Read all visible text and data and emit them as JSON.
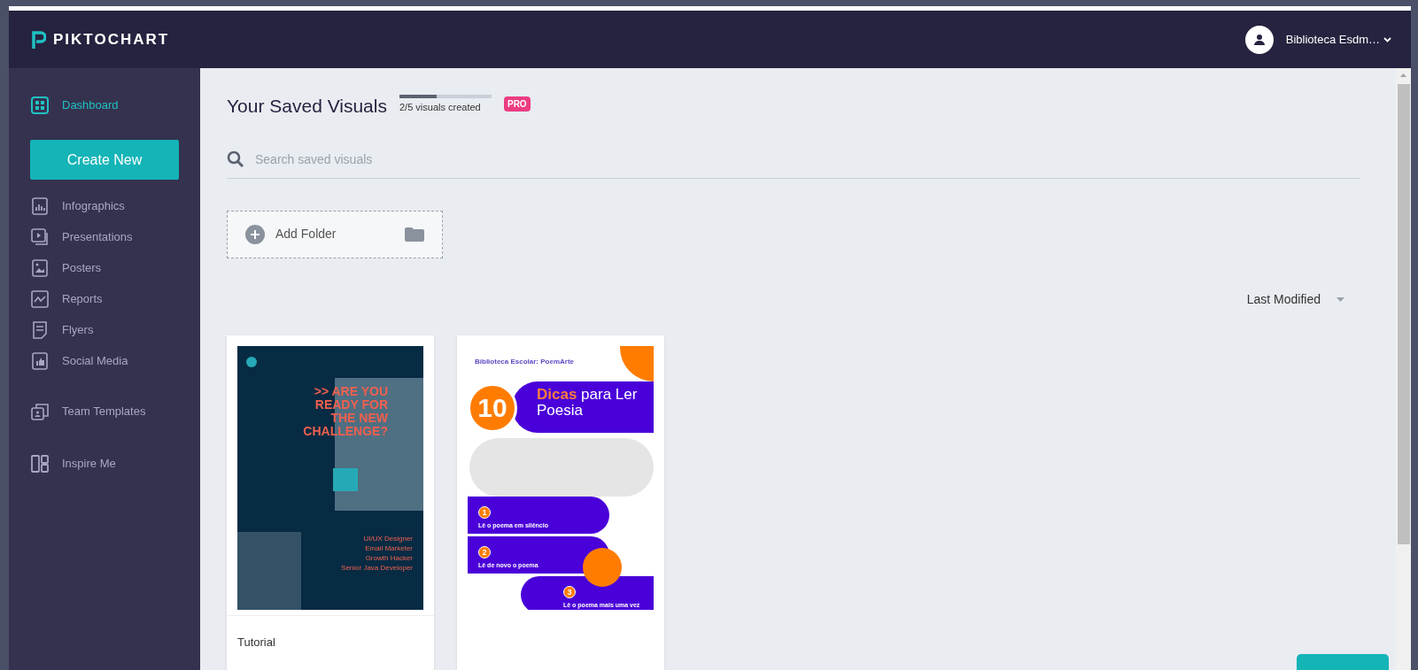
{
  "brand": {
    "name": "PIKTOCHART"
  },
  "account": {
    "name": "Biblioteca Esdm…"
  },
  "sidebar": {
    "items": [
      {
        "kind": "link",
        "label": "Dashboard",
        "selected": true
      },
      {
        "kind": "button",
        "label": "Create New",
        "selected": false
      },
      {
        "kind": "link",
        "label": "Infographics",
        "selected": false
      },
      {
        "kind": "link",
        "label": "Presentations",
        "selected": false
      },
      {
        "kind": "link",
        "label": "Posters",
        "selected": false
      },
      {
        "kind": "link",
        "label": "Reports",
        "selected": false
      },
      {
        "kind": "link",
        "label": "Flyers",
        "selected": false
      },
      {
        "kind": "link",
        "label": "Social Media",
        "selected": false
      },
      {
        "kind": "link",
        "label": "Team Templates",
        "selected": false
      },
      {
        "kind": "link",
        "label": "Inspire Me",
        "selected": false
      }
    ]
  },
  "header": {
    "title": "Your Saved Visuals",
    "quota": {
      "text": "2/5 visuals created",
      "level": 0.4
    },
    "badge": "PRO"
  },
  "search": {
    "placeholder": "Search saved visuals"
  },
  "add_folder": {
    "label": "Add Folder"
  },
  "sort": {
    "label": "Last Modified"
  },
  "visuals": [
    {
      "kind": "poster",
      "title": "Tutorial",
      "headline": [
        ">> ARE YOU",
        "READY FOR",
        "THE NEW",
        "CHALLENGE?"
      ],
      "roles": [
        "UI/UX Designer",
        "Email Marketer",
        "Growth Hacker",
        "Senior Java Developer"
      ]
    },
    {
      "kind": "infographic",
      "header": "Biblioteca Escolar: PoemArte",
      "number": "10",
      "title_highlight": "Dicas",
      "title": "para Ler Poesia",
      "steps": [
        {
          "number": "1",
          "heading": "Lê o poema em silêncio"
        },
        {
          "number": "2",
          "heading": "Lê de novo o poema"
        },
        {
          "number": "3",
          "heading": "Lê o poema mais uma vez"
        }
      ]
    }
  ]
}
